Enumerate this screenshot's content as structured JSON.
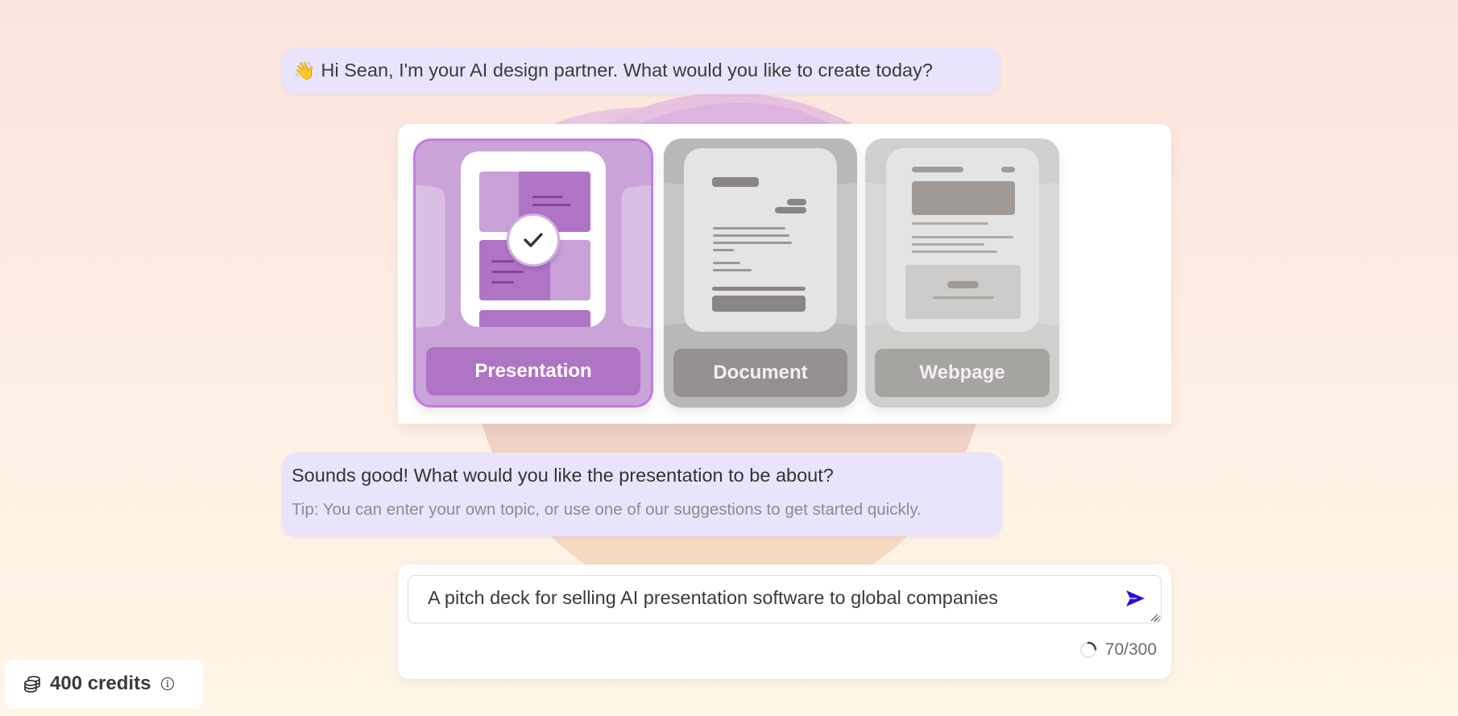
{
  "greeting": {
    "emoji": "👋",
    "text": "Hi Sean, I'm your AI design partner. What would you like to create today?"
  },
  "content_types": [
    {
      "label": "Presentation",
      "selected": true,
      "accent": "#c07ce0"
    },
    {
      "label": "Document",
      "selected": false
    },
    {
      "label": "Webpage",
      "selected": false
    }
  ],
  "prompt": {
    "question": "Sounds good! What would you like the presentation to be about?",
    "tip": "Tip: You can enter your own topic, or use one of our suggestions to get started quickly."
  },
  "input": {
    "value": "A pitch deck for selling AI presentation software to global companies",
    "char_count": 70,
    "char_limit": 300,
    "counter_text": "70/300",
    "send_icon": "send-icon",
    "send_color": "#2a10d4"
  },
  "credits": {
    "label": "400 credits",
    "icon": "coins-icon",
    "info_icon": "info-icon"
  }
}
